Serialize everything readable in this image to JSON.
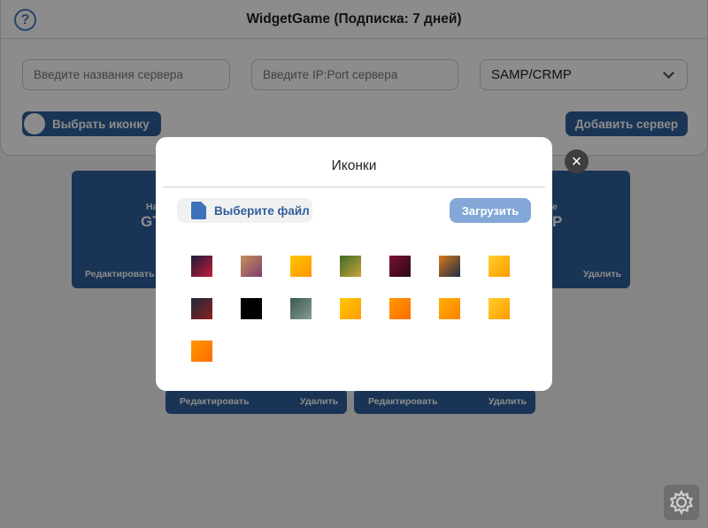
{
  "app": {
    "title": "WidgetGame (Подписка: 7 дней)",
    "help_icon": "?"
  },
  "form": {
    "server_name_placeholder": "Введите названия сервера",
    "server_ip_placeholder": "Введите IP:Port сервера",
    "game_type_selected": "SAMP/CRMP",
    "choose_icon_label": "Выбрать иконку",
    "add_server_label": "Добавить сервер"
  },
  "cards": [
    {
      "small_label": "На",
      "big_label": "GT",
      "edit_label": "Редактировать"
    },
    {
      "small_label": "е",
      "big_label": "P",
      "delete_label": "Удалить"
    },
    {
      "edit_label": "Редактировать",
      "delete_label": "Удалить"
    },
    {
      "edit_label": "Редактировать",
      "delete_label": "Удалить"
    }
  ],
  "modal": {
    "title": "Иконки",
    "choose_file_label": "Выберите файл",
    "upload_label": "Загрузить",
    "close_icon": "×",
    "icons": [
      {
        "name": "icon-1",
        "colors": [
          "#1c1c3a",
          "#c21d3a"
        ]
      },
      {
        "name": "icon-2",
        "colors": [
          "#c78f5b",
          "#7b3f6b"
        ]
      },
      {
        "name": "icon-3",
        "colors": [
          "#ffc400",
          "#ff9600"
        ]
      },
      {
        "name": "icon-4",
        "colors": [
          "#3b6b2a",
          "#c9a23a"
        ]
      },
      {
        "name": "icon-5",
        "colors": [
          "#7a1030",
          "#2a0a18"
        ]
      },
      {
        "name": "icon-6",
        "colors": [
          "#d77a1a",
          "#1c2c4a"
        ]
      },
      {
        "name": "icon-7",
        "colors": [
          "#ffcf2a",
          "#ff9a00"
        ]
      },
      {
        "name": "icon-8",
        "colors": [
          "#1e2c3a",
          "#8a2020"
        ]
      },
      {
        "name": "icon-9",
        "colors": [
          "#000000",
          "#000000"
        ]
      },
      {
        "name": "icon-10",
        "colors": [
          "#3a5a4a",
          "#8a9a9a"
        ]
      },
      {
        "name": "icon-11",
        "colors": [
          "#ffc800",
          "#ff9d00"
        ]
      },
      {
        "name": "icon-12",
        "colors": [
          "#ff9a00",
          "#ff6a00"
        ]
      },
      {
        "name": "icon-13",
        "colors": [
          "#ffb000",
          "#ff8000"
        ]
      },
      {
        "name": "icon-14",
        "colors": [
          "#ffcf2a",
          "#ff9a00"
        ]
      },
      {
        "name": "icon-15",
        "colors": [
          "#ff9a00",
          "#ff6a00"
        ]
      }
    ]
  },
  "settings_icon": "gear-icon"
}
